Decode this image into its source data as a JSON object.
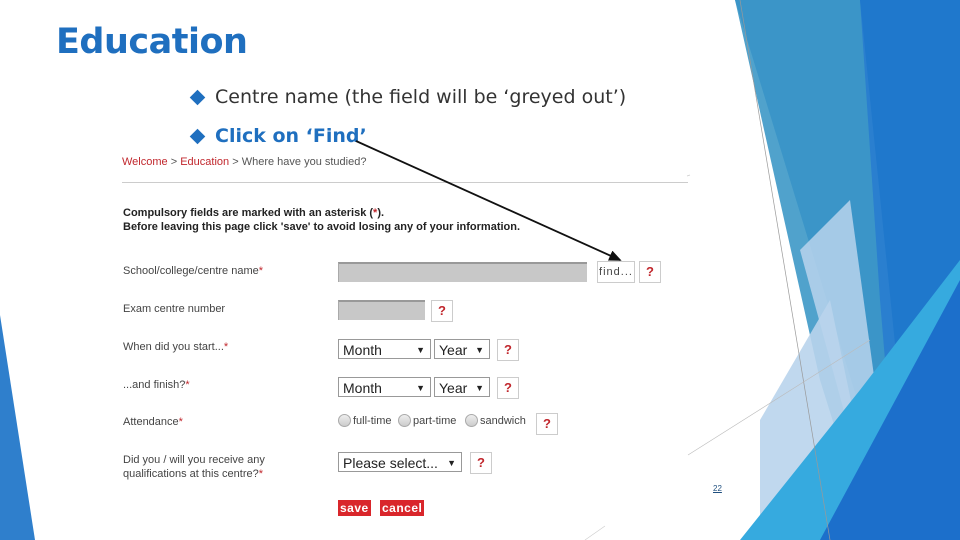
{
  "slide": {
    "title": "Education",
    "bullets": [
      "Centre name (the field will be ‘greyed out’)",
      "Click on ‘Find’"
    ],
    "page_number": "22"
  },
  "breadcrumb": {
    "items": [
      "Welcome",
      "Education",
      "Where have you studied?"
    ],
    "separator": ">"
  },
  "notice": {
    "line1_before": "Compulsory fields are marked with an asterisk (",
    "asterisk": "*",
    "line1_after": ").",
    "line2": "Before leaving this page click 'save' to avoid losing any of your information."
  },
  "form": {
    "required_mark": "*",
    "centre_name": {
      "label": "School/college/centre name",
      "value": "",
      "find_label": "find...",
      "help": "?"
    },
    "exam_centre": {
      "label": "Exam centre number",
      "value": "",
      "help": "?"
    },
    "start": {
      "label": "When did you start...",
      "month": "Month",
      "year": "Year",
      "help": "?"
    },
    "finish": {
      "label": "...and finish?",
      "month": "Month",
      "year": "Year",
      "help": "?"
    },
    "attendance": {
      "label": "Attendance",
      "options": [
        "full-time",
        "part-time",
        "sandwich"
      ],
      "help": "?"
    },
    "qualifications": {
      "label_line1": "Did you / will you receive any",
      "label_line2": "qualifications at this centre?",
      "value": "Please select...",
      "help": "?"
    },
    "save_label": "save",
    "cancel_label": "cancel"
  },
  "colors": {
    "accent": "#1f6fbf",
    "link_red": "#c1272d",
    "button_red": "#d9262b"
  }
}
